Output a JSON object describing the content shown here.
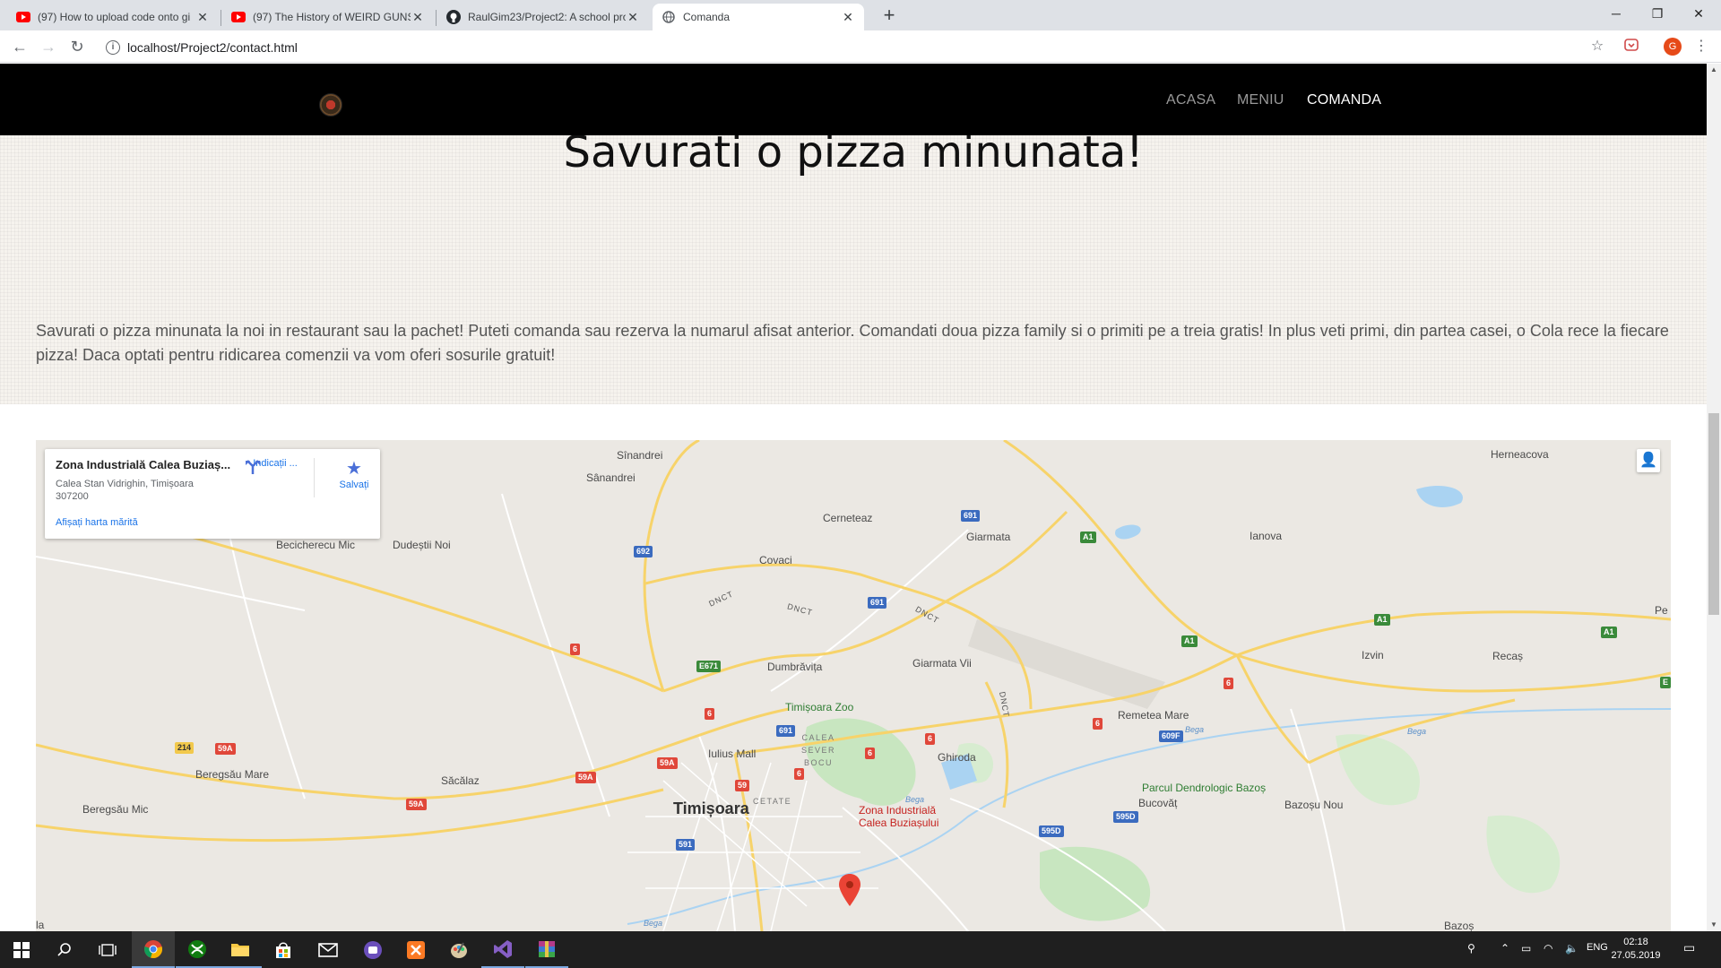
{
  "browser": {
    "tabs": [
      {
        "title": "(97) How to upload code onto gi",
        "icon": "youtube-icon",
        "active": false
      },
      {
        "title": "(97) The History of WEIRD GUNS",
        "icon": "youtube-icon",
        "active": false
      },
      {
        "title": "RaulGim23/Project2: A school pro",
        "icon": "github-icon",
        "active": false
      },
      {
        "title": "Comanda",
        "icon": "globe-icon",
        "active": true
      }
    ],
    "url": "localhost/Project2/contact.html",
    "profile_initial": "G"
  },
  "site": {
    "nav": {
      "items": [
        {
          "label": "ACASA",
          "active": false
        },
        {
          "label": "MENIU",
          "active": false
        },
        {
          "label": "COMANDA",
          "active": true
        }
      ]
    },
    "hero": {
      "title": "Savurati o pizza minunata!",
      "text": "Savurati o pizza minunata la noi in restaurant sau la pachet! Puteti comanda sau rezerva la numarul afisat anterior. Comandati doua pizza family si o primiti pe a treia gratis! In plus veti primi, din partea casei, o Cola rece la fiecare pizza! Daca optati pentru ridicarea comenzii va vom oferi sosurile gratuit!"
    }
  },
  "map": {
    "card": {
      "title": "Zona Industrială Calea Buziaș...",
      "address": "Calea Stan Vidrighin, Timișoara 307200",
      "directions_label": "Indicații ...",
      "save_label": "Salvați",
      "larger_map_label": "Afișați harta mărită"
    },
    "places": {
      "sinandrei1": "Sînandrei",
      "sanandrei": "Sânandrei",
      "herneacova": "Herneacova",
      "cerneteaz": "Cerneteaz",
      "giarmata": "Giarmata",
      "ianova": "Ianova",
      "becicherecu": "Becicherecu Mic",
      "dudestii": "Dudeștii Noi",
      "covaci": "Covaci",
      "dumbravita": "Dumbrăvița",
      "giarmata_vii": "Giarmata Vii",
      "izvin": "Izvin",
      "recas": "Recaș",
      "pe": "Pe",
      "zoo": "Timișoara Zoo",
      "remetea": "Remetea Mare",
      "cetate_sb": "CALEA SEVER BOCU",
      "iulius": "Iulius Mall",
      "ghiroda": "Ghiroda",
      "beregsau_mare": "Beregsău Mare",
      "sacalaz": "Săcălaz",
      "parcul": "Parcul Dendrologic Bazoș",
      "bucovat": "Bucovăț",
      "cetate": "CETATE",
      "timisoara": "Timișoara",
      "pin_label": "Zona Industrială Calea Buziașului",
      "bazosu_nou": "Bazoșu Nou",
      "beregsau_mic": "Beregsău Mic",
      "bazos": "Bazoș",
      "la": "la",
      "bega1": "Bega",
      "bega2": "Bega",
      "bega3": "Bega",
      "bega4": "Bega"
    },
    "road_labels": [
      "DNCT",
      "DNCT",
      "DNCT",
      "DNCT"
    ],
    "shields": [
      "692",
      "691",
      "691",
      "A1",
      "A1",
      "A1",
      "A1",
      "6",
      "6",
      "6",
      "6",
      "6",
      "6",
      "E671",
      "691",
      "59A",
      "59A",
      "59A",
      "59A",
      "214",
      "59",
      "6",
      "609F",
      "595D",
      "595D",
      "591",
      "E"
    ]
  },
  "taskbar": {
    "lang": "ENG",
    "time": "02:18",
    "date": "27.05.2019"
  }
}
